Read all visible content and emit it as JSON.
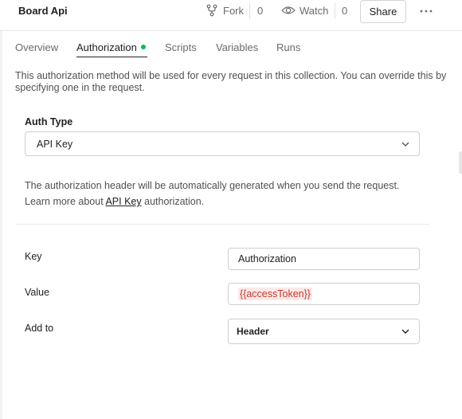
{
  "header": {
    "title": "Board Api",
    "fork_label": "Fork",
    "fork_count": "0",
    "watch_label": "Watch",
    "watch_count": "0",
    "share_label": "Share"
  },
  "tabs": [
    {
      "label": "Overview",
      "active": false
    },
    {
      "label": "Authorization",
      "active": true,
      "status_dot_color": "#0cbb52"
    },
    {
      "label": "Scripts",
      "active": false
    },
    {
      "label": "Variables",
      "active": false
    },
    {
      "label": "Runs",
      "active": false
    }
  ],
  "auth": {
    "intro": "This authorization method will be used for every request in this collection. You can override this by specifying one in the request.",
    "type_label": "Auth Type",
    "type_value": "API Key",
    "note_line1": "The authorization header will be automatically generated when you send the request.",
    "note_prefix": "Learn more about ",
    "note_link": "API Key",
    "note_suffix": " authorization.",
    "key_label": "Key",
    "key_value": "Authorization",
    "value_label": "Value",
    "value_value": "{{accessToken}}",
    "add_to_label": "Add to",
    "add_to_value": "Header"
  },
  "colors": {
    "accent_dot": "#0cbb52",
    "variable_token_text": "#c0392b",
    "variable_token_bg": "#fde8e8"
  }
}
